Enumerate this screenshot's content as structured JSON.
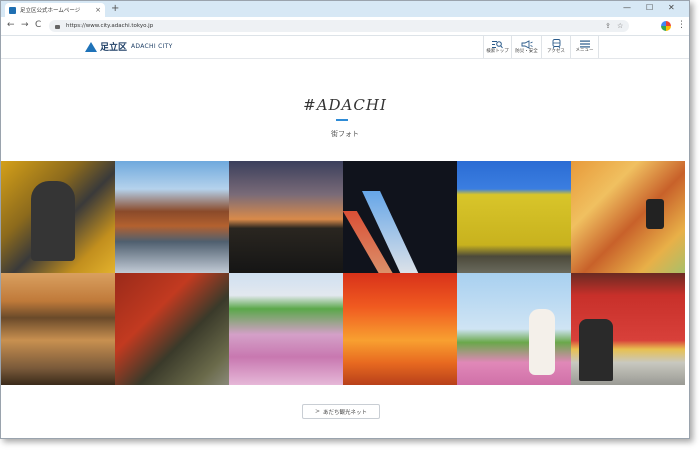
{
  "browser": {
    "tab_title": "足立区公式ホームページ",
    "tab_close": "×",
    "new_tab": "+",
    "url": "https://www.city.adachi.tokyo.jp",
    "back": "←",
    "forward": "→",
    "reload": "C",
    "share": "⇪",
    "bookmark": "☆",
    "menu": "⋮",
    "minimize": "—",
    "maximize": "☐",
    "close": "✕"
  },
  "site": {
    "logo_jp": "足立区",
    "logo_en": "ADACHI CITY",
    "nav": [
      {
        "label": "検索トップ",
        "icon": "search-icon"
      },
      {
        "label": "防災・安全",
        "icon": "megaphone-icon"
      },
      {
        "label": "アクセス",
        "icon": "train-icon"
      },
      {
        "label": "メニュー",
        "icon": "hamburger-icon"
      }
    ]
  },
  "main": {
    "heading": "#ADACHI",
    "subheading": "街フォト",
    "cta_arrow": ">",
    "cta_label": "あだち観光ネット",
    "accent_color": "#2e8bd6"
  },
  "photos": [
    "komainu-autumn-photo",
    "lake-trees-reflection-photo",
    "sunset-bridge-photo",
    "night-traffic-photo",
    "ginkgo-trees-photo",
    "autumn-lantern-photo",
    "sunset-pond-ducks-photo",
    "red-maple-garden-photo",
    "cosmos-field-photographer-photo",
    "red-autumn-path-photo",
    "kimono-girl-cosmos-photo",
    "red-train-children-photo"
  ]
}
